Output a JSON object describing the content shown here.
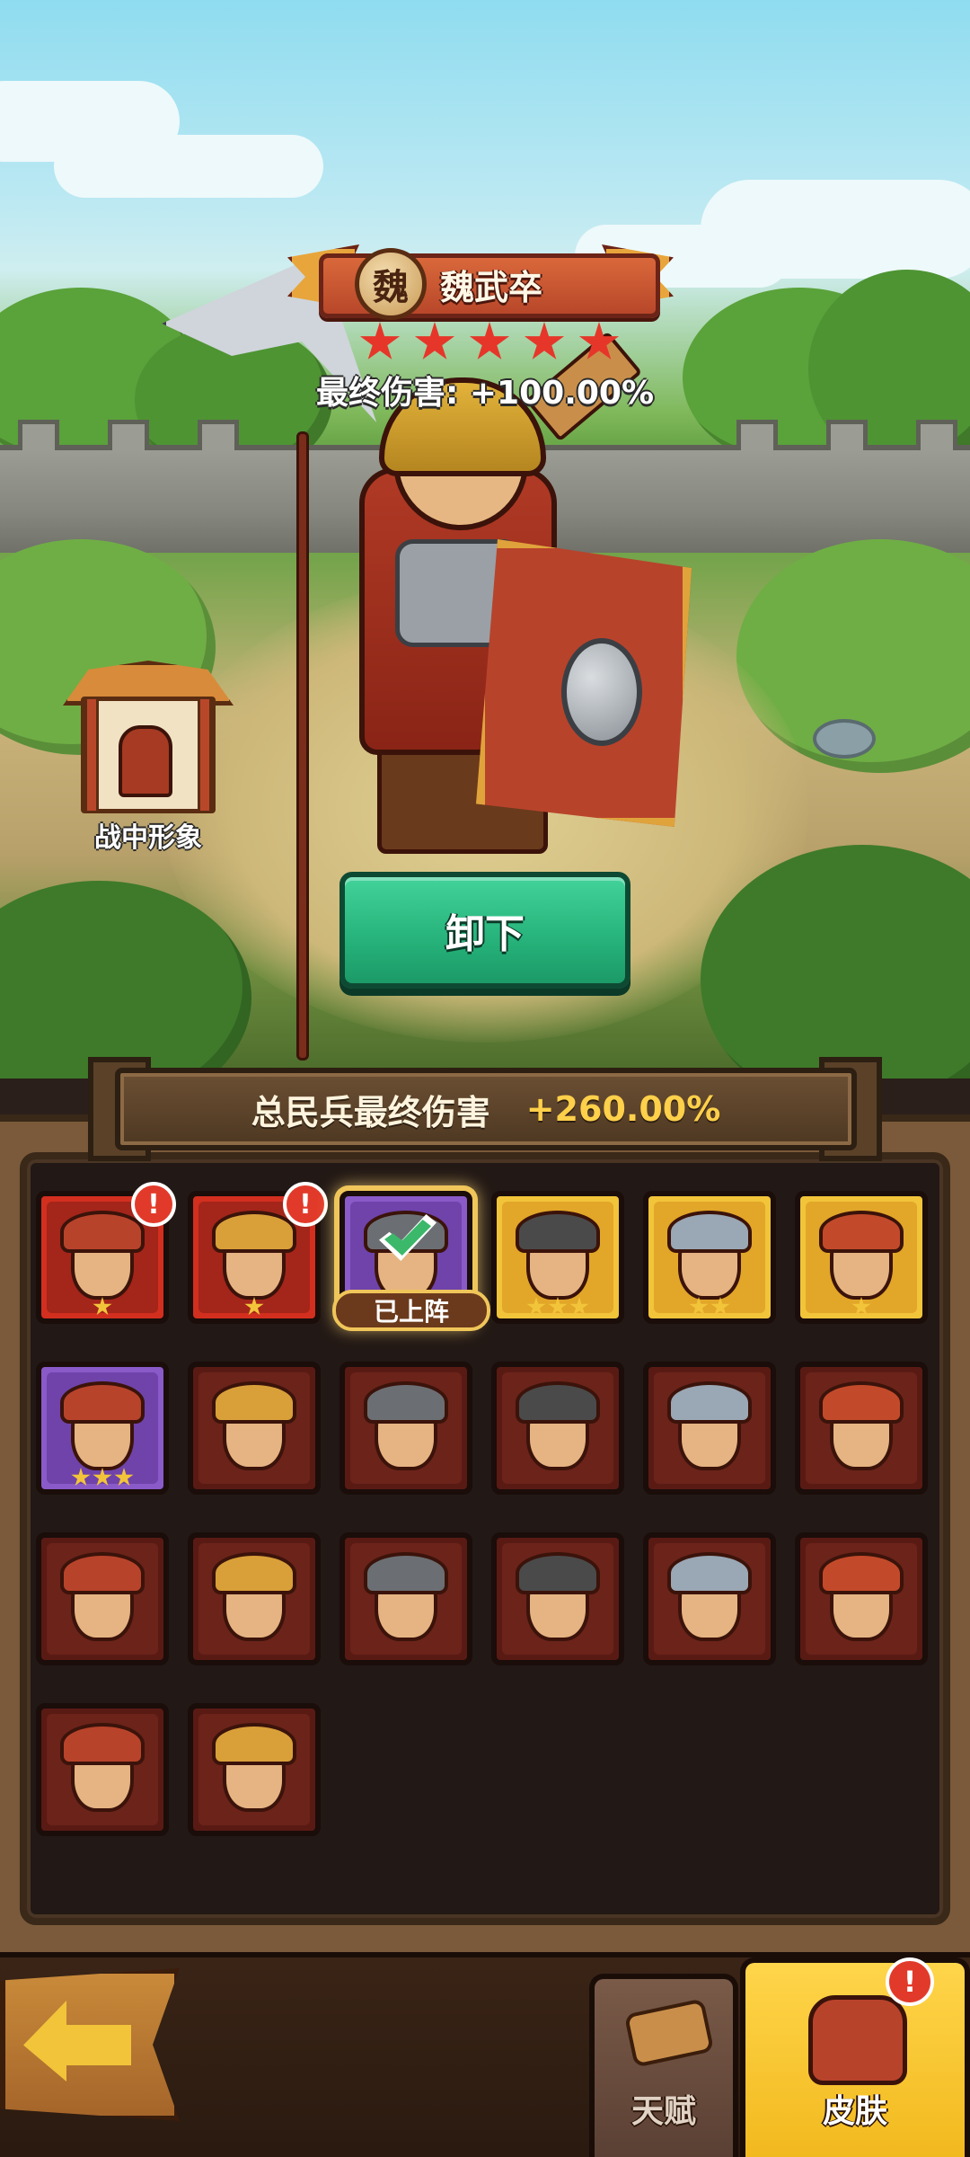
{
  "unit": {
    "faction": "魏",
    "name": "魏武卒",
    "star_count": 5,
    "final_damage": "最终伤害: +100.00%"
  },
  "battle_image": {
    "label": "战中形象"
  },
  "actions": {
    "unequip_label": "卸下"
  },
  "bonus": {
    "label": "总民兵最终伤害",
    "value": "+260.00%"
  },
  "skins": [
    {
      "frame": "red",
      "stars": 1,
      "alert": true,
      "selected": false,
      "deployed": false
    },
    {
      "frame": "red",
      "stars": 1,
      "alert": true,
      "selected": false,
      "deployed": false
    },
    {
      "frame": "purple",
      "stars": 0,
      "alert": false,
      "selected": true,
      "deployed": true
    },
    {
      "frame": "gold",
      "stars": 3,
      "alert": false,
      "selected": false,
      "deployed": false
    },
    {
      "frame": "gold",
      "stars": 2,
      "alert": false,
      "selected": false,
      "deployed": false
    },
    {
      "frame": "gold",
      "stars": 1,
      "alert": false,
      "selected": false,
      "deployed": false
    },
    {
      "frame": "purple",
      "stars": 3,
      "alert": false,
      "selected": false,
      "deployed": false
    },
    {
      "frame": "dark",
      "stars": 0,
      "alert": false,
      "selected": false,
      "deployed": false
    },
    {
      "frame": "dark",
      "stars": 0,
      "alert": false,
      "selected": false,
      "deployed": false
    },
    {
      "frame": "dark",
      "stars": 0,
      "alert": false,
      "selected": false,
      "deployed": false
    },
    {
      "frame": "dark",
      "stars": 0,
      "alert": false,
      "selected": false,
      "deployed": false
    },
    {
      "frame": "dark",
      "stars": 0,
      "alert": false,
      "selected": false,
      "deployed": false
    },
    {
      "frame": "dark",
      "stars": 0,
      "alert": false,
      "selected": false,
      "deployed": false
    },
    {
      "frame": "dark",
      "stars": 0,
      "alert": false,
      "selected": false,
      "deployed": false
    },
    {
      "frame": "dark",
      "stars": 0,
      "alert": false,
      "selected": false,
      "deployed": false
    },
    {
      "frame": "dark",
      "stars": 0,
      "alert": false,
      "selected": false,
      "deployed": false
    },
    {
      "frame": "dark",
      "stars": 0,
      "alert": false,
      "selected": false,
      "deployed": false
    },
    {
      "frame": "dark",
      "stars": 0,
      "alert": false,
      "selected": false,
      "deployed": false
    },
    {
      "frame": "dark",
      "stars": 0,
      "alert": false,
      "selected": false,
      "deployed": false
    },
    {
      "frame": "dark",
      "stars": 0,
      "alert": false,
      "selected": false,
      "deployed": false
    }
  ],
  "deployed_label": "已上阵",
  "alert_glyph": "!",
  "tabs": {
    "talent_label": "天赋",
    "skin_label": "皮肤"
  },
  "colors": {
    "accent_green": "#26b27a",
    "star_red": "#e6362a",
    "star_gold": "#f2c43a",
    "tab_active": "#f2b91e"
  },
  "icons": {
    "faction_badge": "faction-badge-icon",
    "back": "back-arrow-icon",
    "talent": "talent-scroll-icon",
    "skin": "armor-icon",
    "deployed_check": "check-icon"
  }
}
